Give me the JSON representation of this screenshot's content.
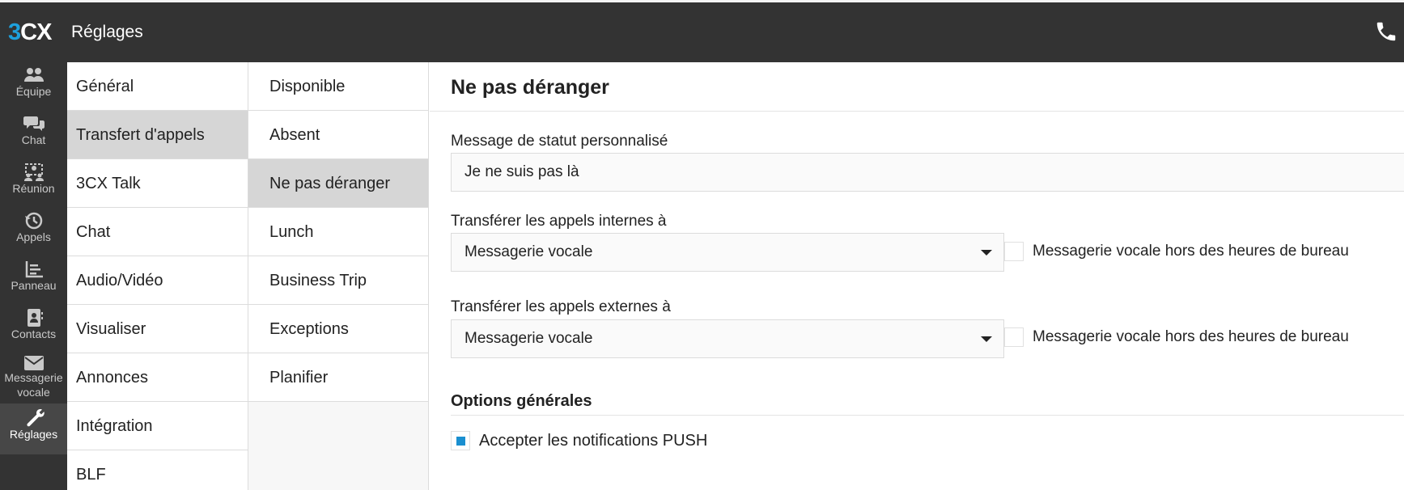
{
  "header": {
    "logo_3": "3",
    "logo_cx": "CX",
    "title": "Réglages",
    "phone_icon": "phone-icon"
  },
  "leftnav": {
    "items": [
      {
        "label": "Équipe",
        "icon": "team-icon"
      },
      {
        "label": "Chat",
        "icon": "chat-icon"
      },
      {
        "label": "Réunion",
        "icon": "meeting-icon"
      },
      {
        "label": "Appels",
        "icon": "history-icon"
      },
      {
        "label": "Panneau",
        "icon": "panel-chart-icon"
      },
      {
        "label": "Contacts",
        "icon": "contacts-icon"
      },
      {
        "label": "Messagerie",
        "label2": "vocale",
        "icon": "envelope-icon"
      },
      {
        "label": "Réglages",
        "icon": "wrench-icon",
        "active": true
      }
    ]
  },
  "settings_menu": {
    "items": [
      "Général",
      "Transfert d'appels",
      "3CX Talk",
      "Chat",
      "Audio/Vidéo",
      "Visualiser",
      "Annonces",
      "Intégration",
      "BLF"
    ],
    "selected": "Transfert d'appels"
  },
  "status_menu": {
    "items": [
      "Disponible",
      "Absent",
      "Ne pas déranger",
      "Lunch",
      "Business Trip",
      "Exceptions",
      "Planifier"
    ],
    "selected": "Ne pas déranger"
  },
  "main": {
    "title": "Ne pas déranger",
    "custom_status_label": "Message de statut personnalisé",
    "custom_status_value": "Je ne suis pas là",
    "internal_label": "Transférer les appels internes à",
    "internal_value": "Messagerie vocale",
    "internal_checkbox_label": "Messagerie vocale hors des heures de bureau",
    "internal_checkbox_checked": false,
    "external_label": "Transférer les appels externes à",
    "external_value": "Messagerie vocale",
    "external_checkbox_label": "Messagerie vocale hors des heures de bureau",
    "external_checkbox_checked": false,
    "options_title": "Options générales",
    "push_label": "Accepter les notifications PUSH",
    "push_checked": true
  },
  "colors": {
    "topbar": "#333333",
    "accent": "#1ea0dc",
    "selected_row": "#d6d6d6"
  }
}
